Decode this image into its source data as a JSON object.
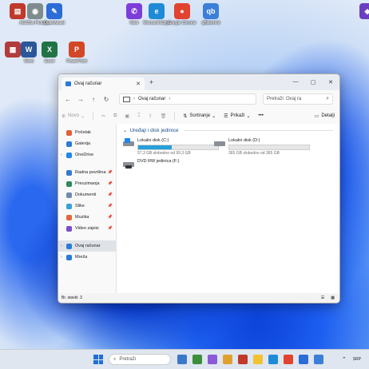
{
  "desktop": {
    "icons": [
      {
        "label": "",
        "color": "#c0392b",
        "glyph": "▤"
      },
      {
        "label": "AG/25w Picture...",
        "color": "#7f8c8d",
        "glyph": "◉"
      },
      {
        "label": "QuickAssist",
        "color": "#2b6cd6",
        "glyph": "✎"
      },
      {
        "label": "Viber",
        "color": "#7d3dd8",
        "glyph": "✆"
      },
      {
        "label": "Microsoft Edge",
        "color": "#1f8bd6",
        "glyph": "e"
      },
      {
        "label": "Google Chrome",
        "color": "#e3422f",
        "glyph": "●"
      },
      {
        "label": "qBittorrent",
        "color": "#3b7fd8",
        "glyph": "qb"
      },
      {
        "label": "",
        "color": "#6b3fbf",
        "glyph": "◆"
      },
      {
        "label": "",
        "color": "#b23b3b",
        "glyph": "▦"
      },
      {
        "label": "Word",
        "color": "#2b579a",
        "glyph": "W"
      },
      {
        "label": "Excel",
        "color": "#217346",
        "glyph": "X"
      },
      {
        "label": "PowerPoint",
        "color": "#d24726",
        "glyph": "P"
      }
    ]
  },
  "explorer": {
    "tab_title": "Ovaj računar",
    "new_tab": "+",
    "address": "Ovaj računar",
    "search_placeholder": "Pretraži: Ovaj ra",
    "toolbar": {
      "new": "Novo",
      "sort": "Sortiranje",
      "view": "Prikaži",
      "more": "•••",
      "details": "Detalji"
    },
    "sidebar": [
      {
        "label": "Početak",
        "color": "#e0603a",
        "pin": false
      },
      {
        "label": "Galerija",
        "color": "#2b7bd6",
        "pin": false
      },
      {
        "label": "OneDrive",
        "color": "#1e88e5",
        "pin": false
      },
      {
        "label": "Radna površina",
        "color": "#3a78c9",
        "pin": true
      },
      {
        "label": "Preuzimanja",
        "color": "#2e8b57",
        "pin": true
      },
      {
        "label": "Dokumenti",
        "color": "#6e8bad",
        "pin": true
      },
      {
        "label": "Slike",
        "color": "#3b9fd8",
        "pin": true
      },
      {
        "label": "Muzika",
        "color": "#e06a3a",
        "pin": true
      },
      {
        "label": "Video zapisi",
        "color": "#7b4fc9",
        "pin": true
      },
      {
        "label": "Ovaj računar",
        "color": "#2b7bd6",
        "pin": false
      },
      {
        "label": "Mreža",
        "color": "#2b7bd6",
        "pin": false
      }
    ],
    "group_header": "Uređaji i disk jedinice",
    "drives": [
      {
        "name": "Lokalni disk (C:)",
        "free": "57,3 GB slobodno od 99,3 GB",
        "used_fraction": 0.42
      },
      {
        "name": "Lokalni disk (D:)",
        "free": "365 GB slobodno od 365 GB",
        "used_fraction": 0.0
      },
      {
        "name": "DVD RW jedinica (F:)",
        "free": "",
        "used_fraction": null
      }
    ],
    "status": "Br. stavki: 3"
  },
  "taskbar": {
    "search": "Pretraži",
    "lang": "SRP",
    "app_colors": [
      "#3a78c9",
      "#3b8f3b",
      "#8a5ad8",
      "#e0a030",
      "#c0392b",
      "#f1c232",
      "#1f8bd6",
      "#e3422f",
      "#2b6cd6",
      "#3b7fd8"
    ]
  }
}
